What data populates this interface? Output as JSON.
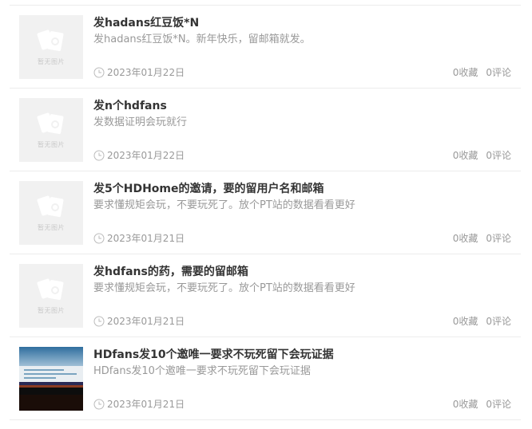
{
  "colors": {
    "text": "#333333",
    "muted": "#999999",
    "divider": "#ececec",
    "placeholder_bg": "#f1f1f1"
  },
  "placeholder_text": "暂无图片",
  "articles": [
    {
      "title": "发hadans红豆饭*N",
      "summary": "发hadans红豆饭*N。新年快乐，留邮箱就发。",
      "date": "2023年01月22日",
      "favorites": "0收藏",
      "comments": "0评论",
      "thumbnail": "placeholder-icon"
    },
    {
      "title": "发n个hdfans",
      "summary": "发数据证明会玩就行",
      "date": "2023年01月22日",
      "favorites": "0收藏",
      "comments": "0评论",
      "thumbnail": "placeholder-icon"
    },
    {
      "title": "发5个HDHome的邀请，要的留用户名和邮箱",
      "summary": "要求懂规矩会玩，不要玩死了。放个PT站的数据看看更好",
      "date": "2023年01月21日",
      "favorites": "0收藏",
      "comments": "0评论",
      "thumbnail": "placeholder-icon"
    },
    {
      "title": "发hdfans的药，需要的留邮箱",
      "summary": "要求懂规矩会玩，不要玩死了。放个PT站的数据看看更好",
      "date": "2023年01月21日",
      "favorites": "0收藏",
      "comments": "0评论",
      "thumbnail": "placeholder-icon"
    },
    {
      "title": "HDfans发10个邀唯一要求不玩死留下会玩证据",
      "summary": "HDfans发10个邀唯一要求不玩死留下会玩证据",
      "date": "2023年01月21日",
      "favorites": "0收藏",
      "comments": "0评论",
      "thumbnail": "screenshot-photo"
    }
  ]
}
